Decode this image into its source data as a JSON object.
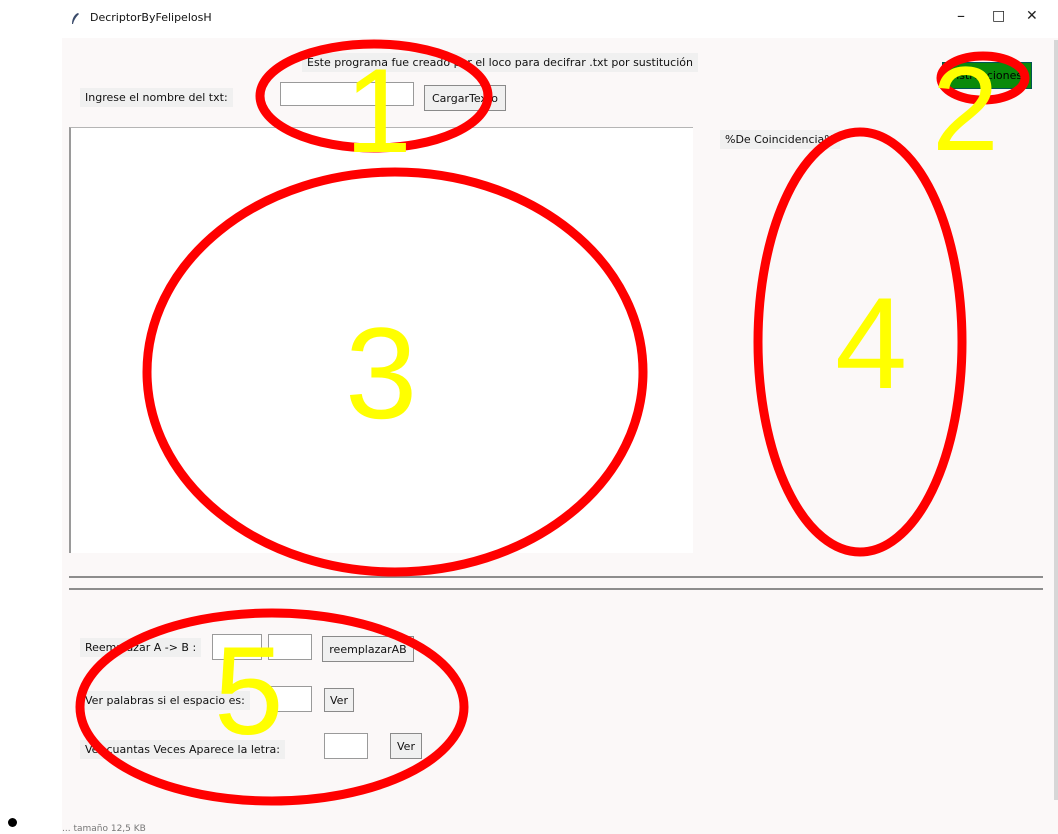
{
  "window": {
    "title": "DecriptorByFelipelosH",
    "minimize_glyph": "–",
    "maximize_glyph": "□",
    "close_glyph": "✕"
  },
  "header": {
    "description": "Este programa fue creado por el loco para decifrar .txt por sustitución",
    "instructions_label": "Instrucciones",
    "accent_color": "#0a8a0a"
  },
  "load": {
    "label": "Ingrese el nombre del txt:",
    "input_value": "",
    "button_label": "CargarTexto"
  },
  "side": {
    "match_label": "%De Coincidencia%"
  },
  "tools": {
    "replace_label": "Reemplazar A -> B :",
    "replace_a_value": "",
    "replace_b_value": "",
    "replace_button": "reemplazarAB",
    "space_label": "Ver palabras si el espacio es:",
    "space_value": "",
    "space_button": "Ver",
    "count_label": "Ver cuantas Veces Aparece la letra:",
    "count_value": "",
    "count_button": "Ver"
  },
  "annotations": {
    "color_ellipse": "#ff0000",
    "color_number": "#ffff00",
    "numbers": [
      "1",
      "2",
      "3",
      "4",
      "5"
    ]
  },
  "status": {
    "text": "... tamaño 12,5 KB"
  }
}
